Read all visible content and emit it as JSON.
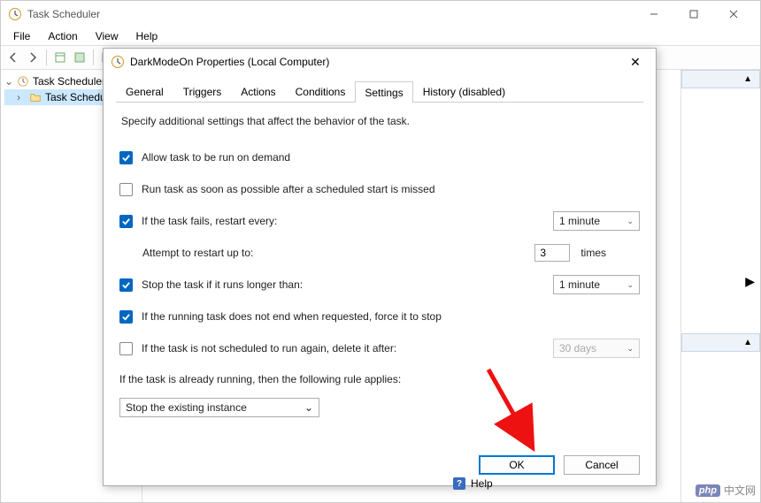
{
  "window": {
    "title": "Task Scheduler",
    "menus": [
      "File",
      "Action",
      "View",
      "Help"
    ]
  },
  "tree": {
    "root": "Task Scheduler (L",
    "child": "Task Schedul"
  },
  "right_pane": {
    "header_placeholder": " "
  },
  "help_strip": {
    "label": "Help"
  },
  "dialog": {
    "title": "DarkModeOn Properties (Local Computer)",
    "tabs": [
      "General",
      "Triggers",
      "Actions",
      "Conditions",
      "Settings",
      "History (disabled)"
    ],
    "active_tab": "Settings",
    "intro": "Specify additional settings that affect the behavior of the task.",
    "allow_on_demand": "Allow task to be run on demand",
    "run_asap": "Run task as soon as possible after a scheduled start is missed",
    "restart_every": "If the task fails, restart every:",
    "restart_interval": "1 minute",
    "attempt_label": "Attempt to restart up to:",
    "attempt_value": "3",
    "attempt_suffix": "times",
    "stop_longer": "Stop the task if it runs longer than:",
    "stop_value": "1 minute",
    "force_stop": "If the running task does not end when requested, force it to stop",
    "delete_after": "If the task is not scheduled to run again, delete it after:",
    "delete_value": "30 days",
    "rule_label": "If the task is already running, then the following rule applies:",
    "rule_value": "Stop the existing instance",
    "ok": "OK",
    "cancel": "Cancel"
  },
  "watermark": {
    "text": "中文网"
  }
}
